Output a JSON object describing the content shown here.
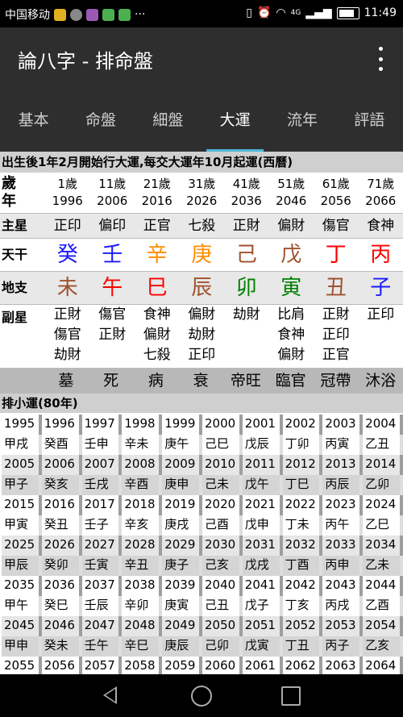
{
  "status": {
    "carrier": "中国移动",
    "dots": "···",
    "network": "4G",
    "time": "11:49"
  },
  "app": {
    "title": "論八字 - 排命盤"
  },
  "tabs": [
    "基本",
    "命盤",
    "細盤",
    "大運",
    "流年",
    "評語"
  ],
  "active_tab": "大運",
  "dayun": {
    "header": "出生後1年2月開始行大運,每交大運年10月起運(西曆)",
    "age_label": "歲年",
    "ages": [
      "1歲",
      "11歲",
      "21歲",
      "31歲",
      "41歲",
      "51歲",
      "61歲",
      "71歲"
    ],
    "years": [
      "1996",
      "2006",
      "2016",
      "2026",
      "2036",
      "2046",
      "2056",
      "2066"
    ],
    "zhuxing_label": "主星",
    "zhuxing": [
      "正印",
      "偏印",
      "正官",
      "七殺",
      "正財",
      "偏財",
      "傷官",
      "食神"
    ],
    "tiangan_label": "天干",
    "tiangan": [
      "癸",
      "壬",
      "辛",
      "庚",
      "己",
      "戊",
      "丁",
      "丙"
    ],
    "tiangan_colors": [
      "#1a1aff",
      "#1a1aff",
      "#ff8c00",
      "#ff8c00",
      "#a0522d",
      "#a0522d",
      "#ff0000",
      "#ff0000"
    ],
    "dizhi_label": "地支",
    "dizhi": [
      "未",
      "午",
      "巳",
      "辰",
      "卯",
      "寅",
      "丑",
      "子"
    ],
    "dizhi_colors": [
      "#a0522d",
      "#ff0000",
      "#ff0000",
      "#a0522d",
      "#008000",
      "#008000",
      "#a0522d",
      "#1a1aff"
    ],
    "fuxing_label": "副星",
    "fuxing": [
      [
        "正財",
        "傷官",
        "劫財"
      ],
      [
        "傷官",
        "正財",
        ""
      ],
      [
        "食神",
        "偏財",
        "七殺"
      ],
      [
        "偏財",
        "劫財",
        "正印"
      ],
      [
        "劫財",
        "",
        ""
      ],
      [
        "比肩",
        "食神",
        "偏財"
      ],
      [
        "正財",
        "正印",
        "正官"
      ],
      [
        "正印",
        "",
        ""
      ]
    ],
    "changsheng": [
      "墓",
      "死",
      "病",
      "衰",
      "帝旺",
      "臨官",
      "冠帶",
      "沐浴"
    ]
  },
  "xiaoyun": {
    "header": "排小運(80年)",
    "rows": [
      {
        "years": [
          "1995",
          "1996",
          "1997",
          "1998",
          "1999",
          "2000",
          "2001",
          "2002",
          "2003",
          "2004"
        ],
        "ganzhi": [
          "甲戌",
          "癸酉",
          "壬申",
          "辛未",
          "庚午",
          "己巳",
          "戊辰",
          "丁卯",
          "丙寅",
          "乙丑"
        ]
      },
      {
        "years": [
          "2005",
          "2006",
          "2007",
          "2008",
          "2009",
          "2010",
          "2011",
          "2012",
          "2013",
          "2014"
        ],
        "ganzhi": [
          "甲子",
          "癸亥",
          "壬戌",
          "辛酉",
          "庚申",
          "己未",
          "戊午",
          "丁巳",
          "丙辰",
          "乙卯"
        ]
      },
      {
        "years": [
          "2015",
          "2016",
          "2017",
          "2018",
          "2019",
          "2020",
          "2021",
          "2022",
          "2023",
          "2024"
        ],
        "ganzhi": [
          "甲寅",
          "癸丑",
          "壬子",
          "辛亥",
          "庚戌",
          "己酉",
          "戊申",
          "丁未",
          "丙午",
          "乙巳"
        ]
      },
      {
        "years": [
          "2025",
          "2026",
          "2027",
          "2028",
          "2029",
          "2030",
          "2031",
          "2032",
          "2033",
          "2034"
        ],
        "ganzhi": [
          "甲辰",
          "癸卯",
          "壬寅",
          "辛丑",
          "庚子",
          "己亥",
          "戊戌",
          "丁酉",
          "丙申",
          "乙未"
        ]
      },
      {
        "years": [
          "2035",
          "2036",
          "2037",
          "2038",
          "2039",
          "2040",
          "2041",
          "2042",
          "2043",
          "2044"
        ],
        "ganzhi": [
          "甲午",
          "癸巳",
          "壬辰",
          "辛卯",
          "庚寅",
          "己丑",
          "戊子",
          "丁亥",
          "丙戌",
          "乙酉"
        ]
      },
      {
        "years": [
          "2045",
          "2046",
          "2047",
          "2048",
          "2049",
          "2050",
          "2051",
          "2052",
          "2053",
          "2054"
        ],
        "ganzhi": [
          "甲申",
          "癸未",
          "壬午",
          "辛巳",
          "庚辰",
          "己卯",
          "戊寅",
          "丁丑",
          "丙子",
          "乙亥"
        ]
      },
      {
        "years": [
          "2055",
          "2056",
          "2057",
          "2058",
          "2059",
          "2060",
          "2061",
          "2062",
          "2063",
          "2064"
        ],
        "ganzhi": []
      }
    ]
  }
}
